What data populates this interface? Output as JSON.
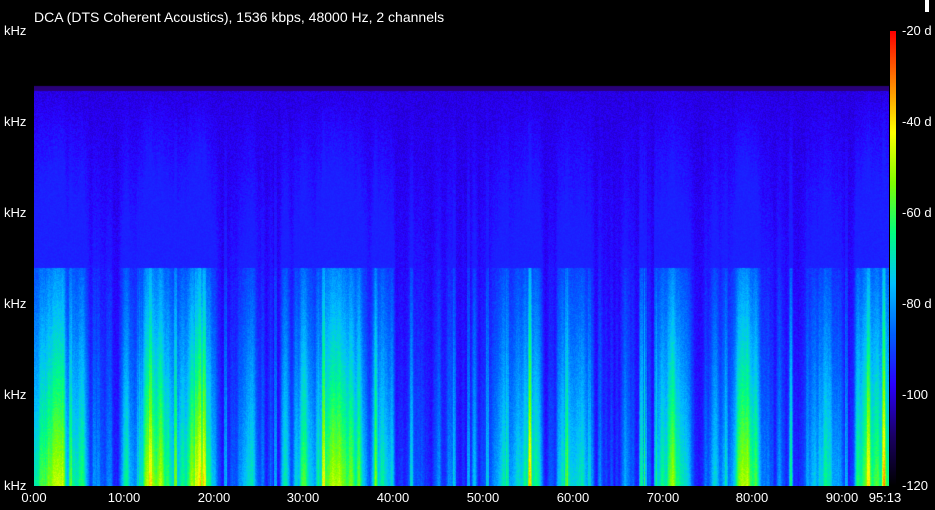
{
  "title": "DCA (DTS Coherent Acoustics), 1536 kbps, 48000 Hz, 2 channels",
  "chart_data": {
    "type": "heatmap",
    "title": "DCA (DTS Coherent Acoustics), 1536 kbps, 48000 Hz, 2 channels",
    "y_tick_labels": [
      "kHz",
      "kHz",
      "kHz",
      "kHz",
      "kHz",
      "kHz"
    ],
    "x_tick_labels": [
      "0:00",
      "10:00",
      "20:00",
      "30:00",
      "40:00",
      "50:00",
      "60:00",
      "70:00",
      "80:00",
      "90:00",
      "95:13"
    ],
    "x_ticks_minutes": [
      0,
      10,
      20,
      30,
      40,
      50,
      60,
      70,
      80,
      90,
      95.22
    ],
    "duration_minutes": 95.22,
    "colorbar_labels": [
      "-20 d",
      "-40 d",
      "-60 d",
      "-80 d",
      "-100",
      "-120"
    ],
    "colorbar_values_db": [
      -20,
      -40,
      -60,
      -80,
      -100,
      -120
    ],
    "colormap": [
      "#000000",
      "#1a0066",
      "#2a00ff",
      "#0060ff",
      "#00c0ff",
      "#00ff80",
      "#80ff00",
      "#ffff00",
      "#ff8000",
      "#ff0000"
    ],
    "cutoff_fraction": 0.875,
    "cutoff_color": "#000000",
    "background_color": "#2600e8"
  }
}
